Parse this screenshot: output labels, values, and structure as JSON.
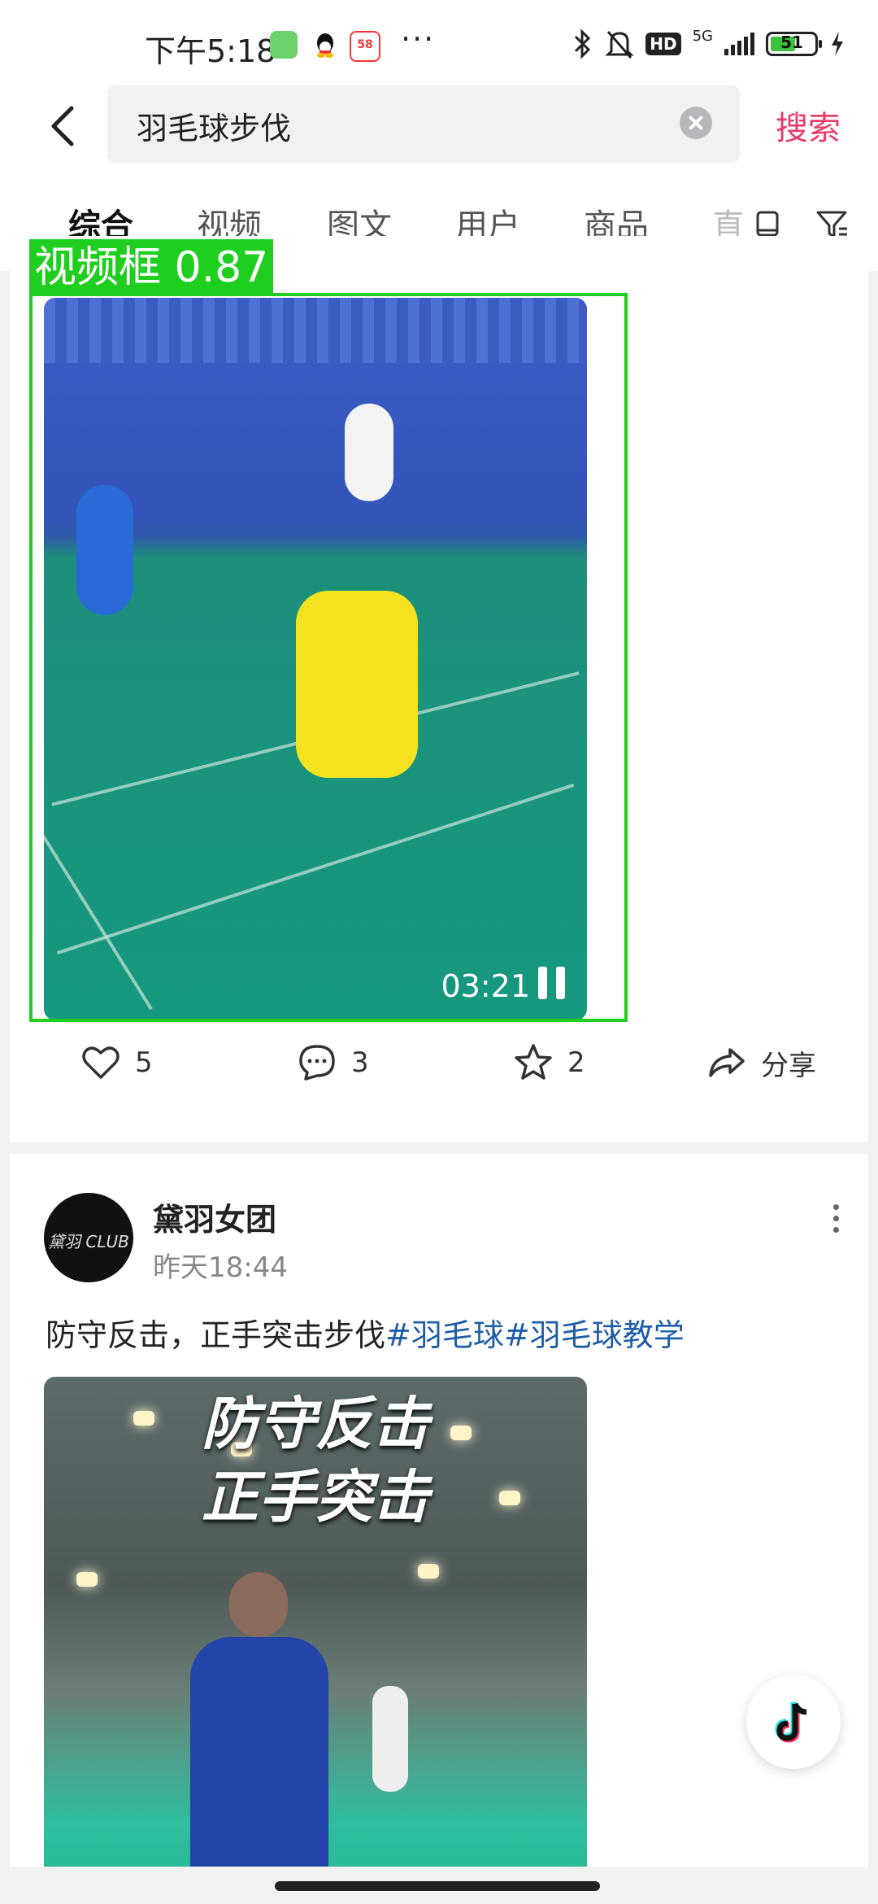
{
  "status_bar": {
    "time": "下午5:18",
    "network": "5G",
    "hd": "HD",
    "battery": "51",
    "icons": [
      "wechat-icon",
      "qq-icon",
      "58-app-icon",
      "more-dots-icon",
      "bluetooth-icon",
      "mute-icon",
      "hd-icon",
      "signal-icon",
      "battery-icon",
      "charging-icon"
    ]
  },
  "header": {
    "search_value": "羽毛球步伐",
    "search_button": "搜索"
  },
  "tabs": [
    "综合",
    "视频",
    "图文",
    "用户",
    "商品",
    "直"
  ],
  "detection": {
    "label": "视频框 0.87",
    "color": "#1fcf1f"
  },
  "post1": {
    "duration": "03:21",
    "likes": "5",
    "comments": "3",
    "favorites": "2",
    "share": "分享"
  },
  "post2": {
    "author": "黛羽女团",
    "avatar_text": "黛羽 CLUB",
    "time": "昨天18:44",
    "text": "防守反击，正手突击步伐",
    "hashtag1": "#羽毛球",
    "hashtag2": "#羽毛球教学",
    "image_caption_line1": "防守反击",
    "image_caption_line2": "正手突击"
  },
  "colors": {
    "accent": "#e83a6a",
    "hashtag": "#1f5ea8"
  }
}
